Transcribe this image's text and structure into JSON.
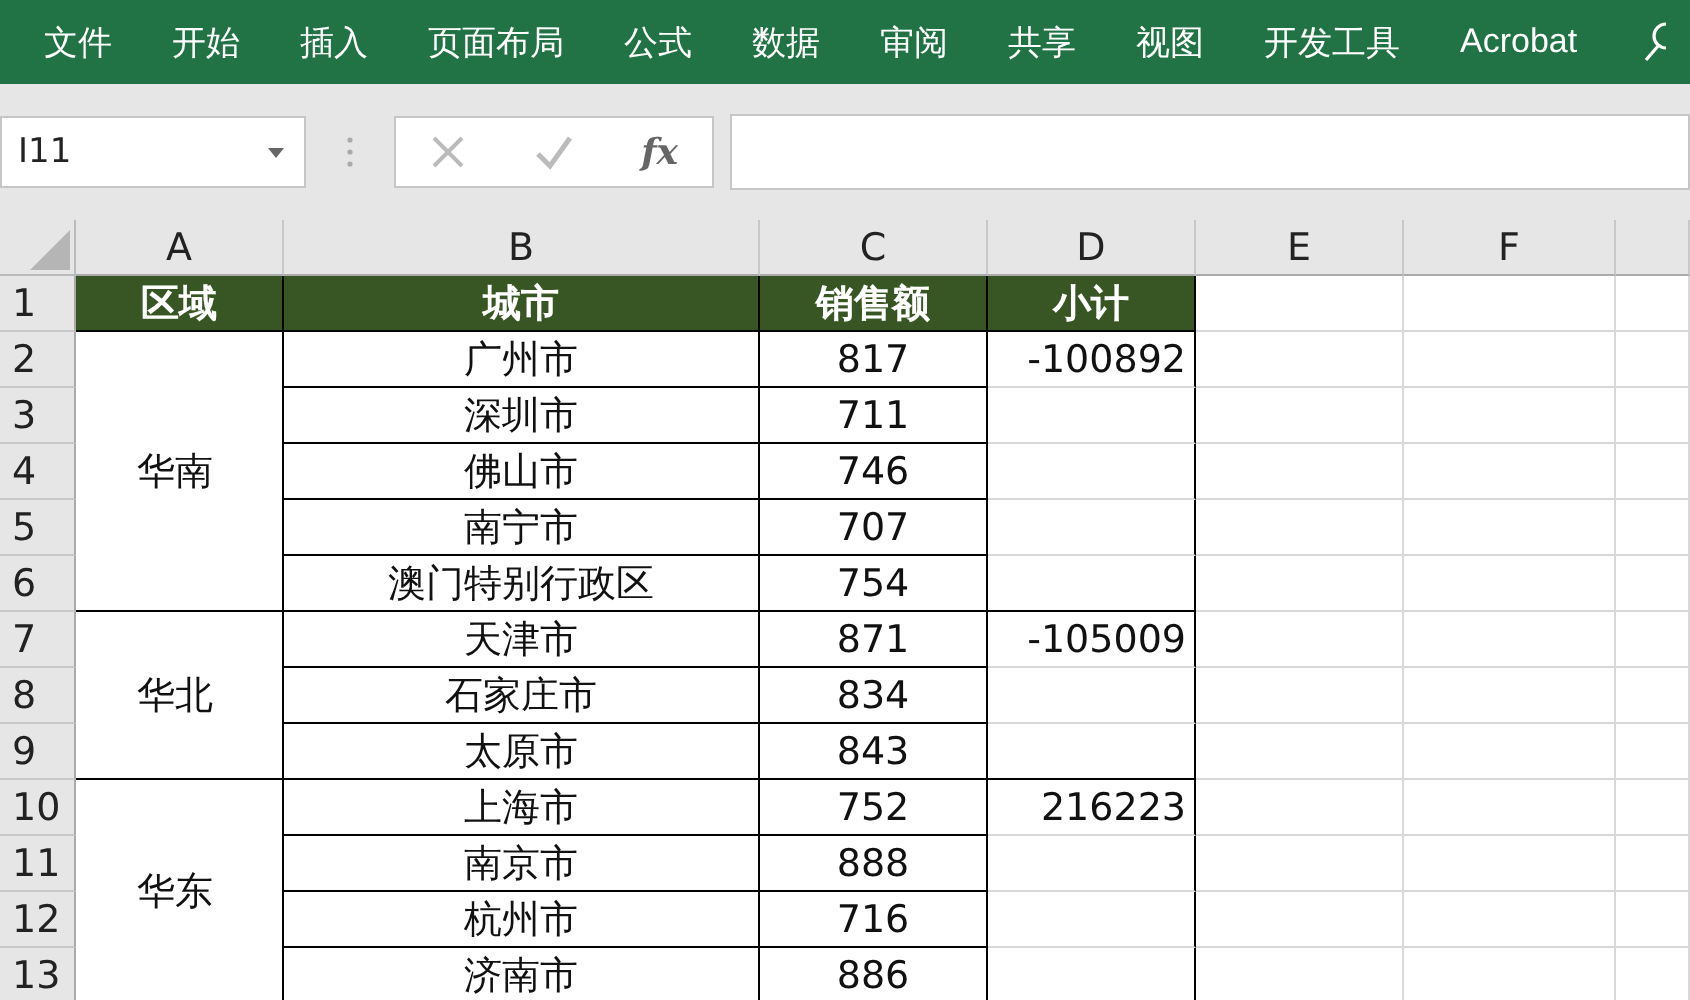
{
  "ribbon": {
    "tabs": [
      "文件",
      "开始",
      "插入",
      "页面布局",
      "公式",
      "数据",
      "审阅",
      "共享",
      "视图",
      "开发工具",
      "Acrobat"
    ]
  },
  "formula_bar": {
    "name_box": "I11",
    "function_label": "fx"
  },
  "sheet": {
    "columns": [
      "A",
      "B",
      "C",
      "D",
      "E",
      "F"
    ],
    "row_numbers": [
      "1",
      "2",
      "3",
      "4",
      "5",
      "6",
      "7",
      "8",
      "9",
      "10",
      "11",
      "12",
      "13"
    ],
    "header": [
      "区域",
      "城市",
      "销售额",
      "小计"
    ],
    "regions": [
      {
        "name": "华南",
        "rows": [
          {
            "city": "广州市",
            "sales": "817",
            "subtotal": "-100892"
          },
          {
            "city": "深圳市",
            "sales": "711"
          },
          {
            "city": "佛山市",
            "sales": "746"
          },
          {
            "city": "南宁市",
            "sales": "707"
          },
          {
            "city": "澳门特别行政区",
            "sales": "754"
          }
        ]
      },
      {
        "name": "华北",
        "rows": [
          {
            "city": "天津市",
            "sales": "871",
            "subtotal": "-105009"
          },
          {
            "city": "石家庄市",
            "sales": "834"
          },
          {
            "city": "太原市",
            "sales": "843"
          }
        ]
      },
      {
        "name": "华东",
        "rows": [
          {
            "city": "上海市",
            "sales": "752",
            "subtotal": "216223"
          },
          {
            "city": "南京市",
            "sales": "888"
          },
          {
            "city": "杭州市",
            "sales": "716"
          },
          {
            "city": "济南市",
            "sales": "886"
          }
        ]
      }
    ]
  }
}
